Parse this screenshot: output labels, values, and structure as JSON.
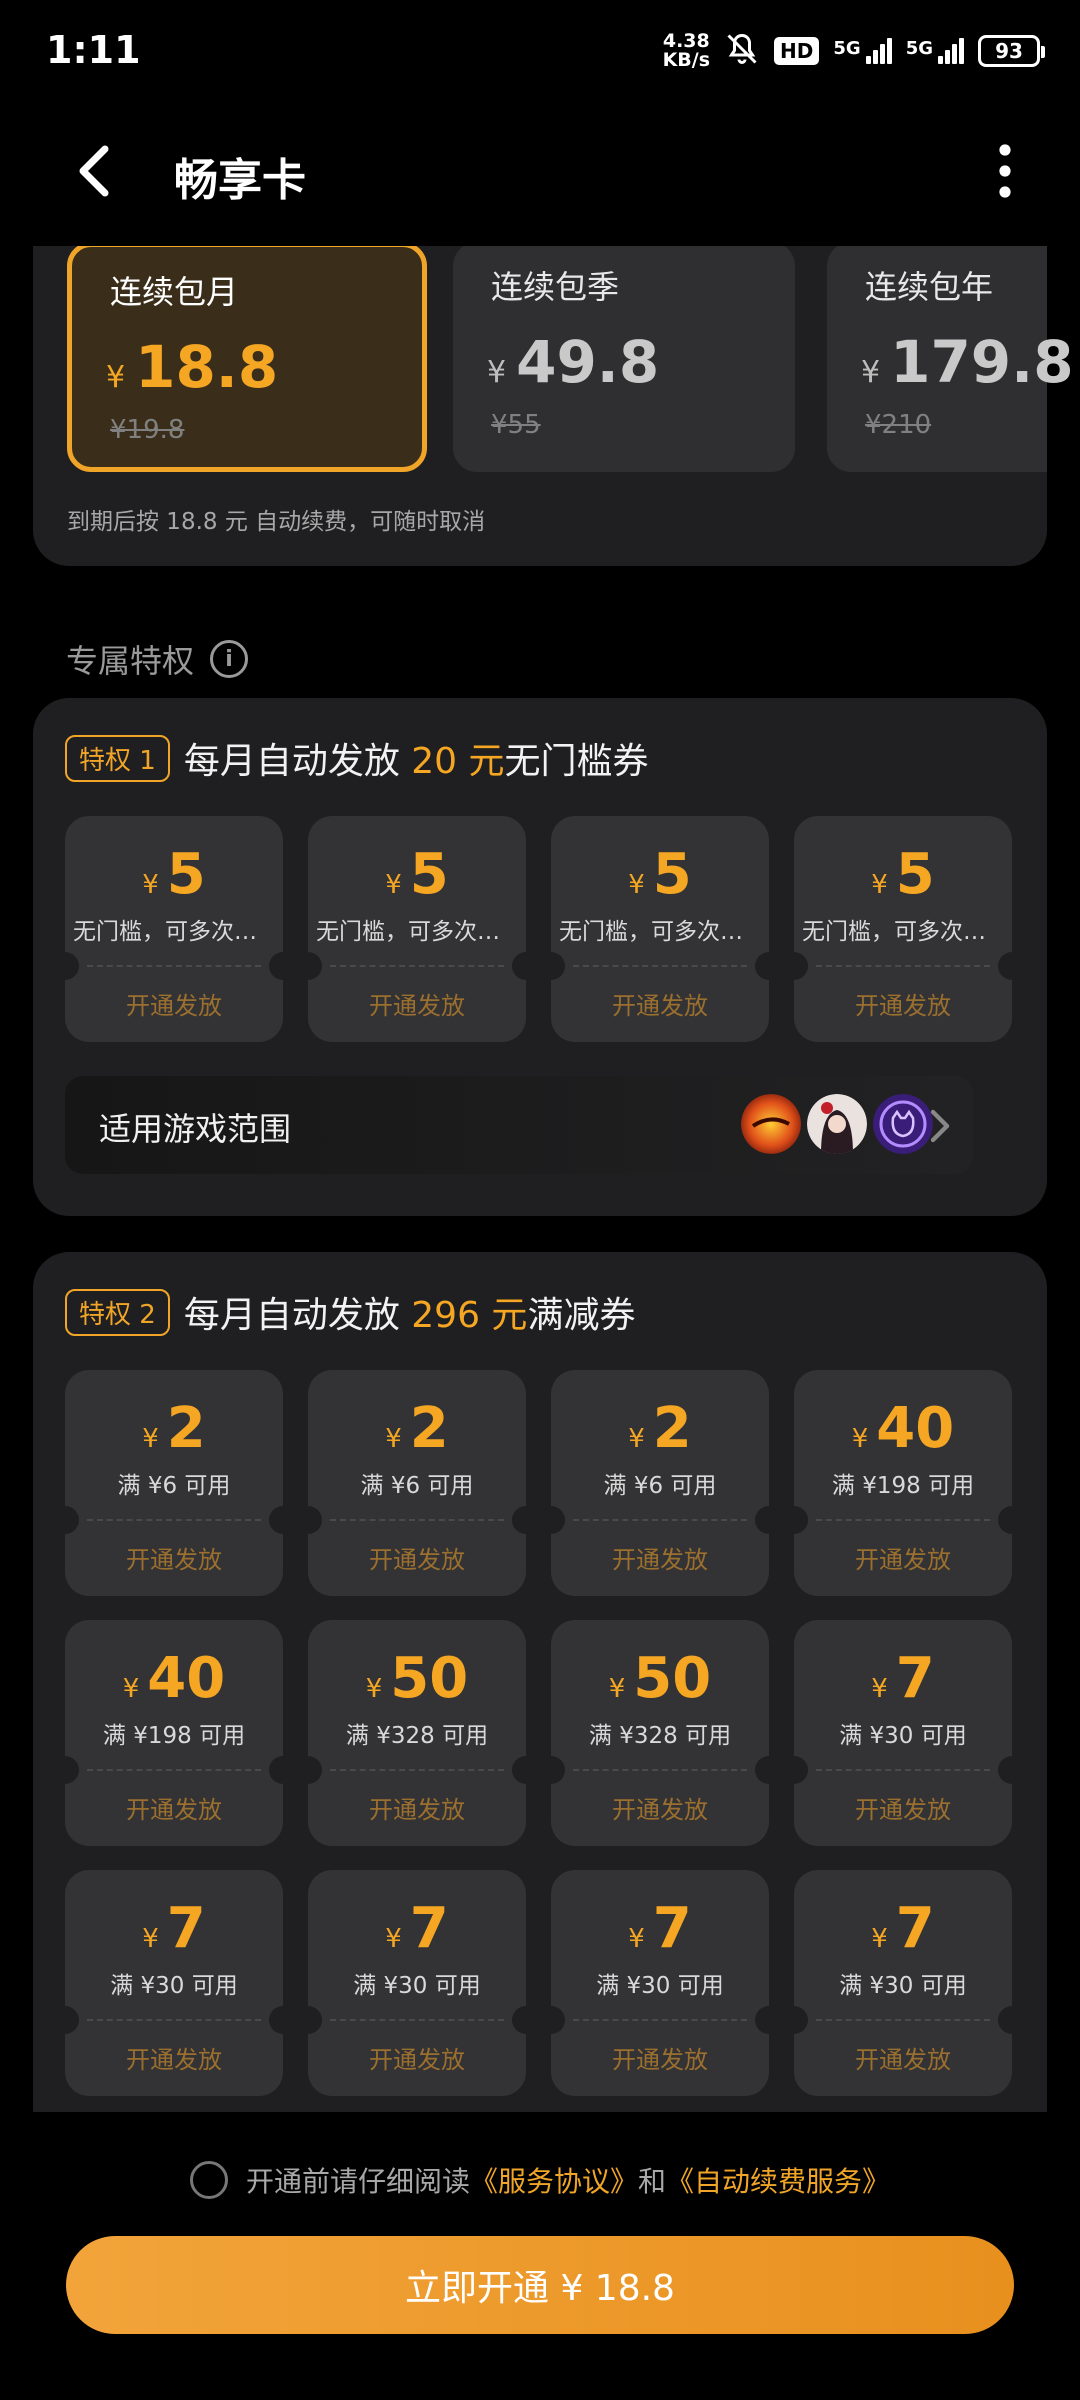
{
  "status_bar": {
    "time": "1:11",
    "speed_value": "4.38",
    "speed_unit": "KB/s",
    "hd_label": "HD",
    "net1": "5G",
    "net2": "5G",
    "battery": "93"
  },
  "header": {
    "title": "畅享卡"
  },
  "plans": {
    "items": [
      {
        "name": "连续包月",
        "currency": "¥",
        "price": "18.8",
        "original": "¥19.8",
        "selected": true
      },
      {
        "name": "连续包季",
        "currency": "¥",
        "price": "49.8",
        "original": "¥55",
        "selected": false
      },
      {
        "name": "连续包年",
        "currency": "¥",
        "price": "179.8",
        "original": "¥210",
        "selected": false
      }
    ],
    "note": "到期后按 18.8 元 自动续费，可随时取消"
  },
  "section": {
    "label": "专属特权"
  },
  "privilege1": {
    "badge": "特权 1",
    "title_pre": "每月自动发放 ",
    "title_amount": "20 元",
    "title_post": "无门槛券",
    "coupons": [
      {
        "currency": "¥",
        "amount": "5",
        "desc": "无门槛，可多次使用",
        "action": "开通发放"
      },
      {
        "currency": "¥",
        "amount": "5",
        "desc": "无门槛，可多次使用",
        "action": "开通发放"
      },
      {
        "currency": "¥",
        "amount": "5",
        "desc": "无门槛，可多次使用",
        "action": "开通发放"
      },
      {
        "currency": "¥",
        "amount": "5",
        "desc": "无门槛，可多次使用",
        "action": "开通发放"
      }
    ],
    "games_label": "适用游戏范围"
  },
  "privilege2": {
    "badge": "特权 2",
    "title_pre": "每月自动发放 ",
    "title_amount": "296 元",
    "title_post": "满减券",
    "coupons": [
      {
        "currency": "¥",
        "amount": "2",
        "desc": "满 ¥6 可用",
        "action": "开通发放"
      },
      {
        "currency": "¥",
        "amount": "2",
        "desc": "满 ¥6 可用",
        "action": "开通发放"
      },
      {
        "currency": "¥",
        "amount": "2",
        "desc": "满 ¥6 可用",
        "action": "开通发放"
      },
      {
        "currency": "¥",
        "amount": "40",
        "desc": "满 ¥198 可用",
        "action": "开通发放"
      },
      {
        "currency": "¥",
        "amount": "40",
        "desc": "满 ¥198 可用",
        "action": "开通发放"
      },
      {
        "currency": "¥",
        "amount": "50",
        "desc": "满 ¥328 可用",
        "action": "开通发放"
      },
      {
        "currency": "¥",
        "amount": "50",
        "desc": "满 ¥328 可用",
        "action": "开通发放"
      },
      {
        "currency": "¥",
        "amount": "7",
        "desc": "满 ¥30 可用",
        "action": "开通发放"
      },
      {
        "currency": "¥",
        "amount": "7",
        "desc": "满 ¥30 可用",
        "action": "开通发放"
      },
      {
        "currency": "¥",
        "amount": "7",
        "desc": "满 ¥30 可用",
        "action": "开通发放"
      },
      {
        "currency": "¥",
        "amount": "7",
        "desc": "满 ¥30 可用",
        "action": "开通发放"
      },
      {
        "currency": "¥",
        "amount": "7",
        "desc": "满 ¥30 可用",
        "action": "开通发放"
      }
    ]
  },
  "agreement": {
    "pre": "开通前请仔细阅读",
    "link1": "《服务协议》",
    "mid": "和",
    "link2": "《自动续费服务》"
  },
  "cta": {
    "label": "立即开通 ¥ 18.8"
  },
  "colors": {
    "accent": "#f5a623",
    "card_bg": "#1f1f21",
    "coupon_bg": "#333335"
  }
}
